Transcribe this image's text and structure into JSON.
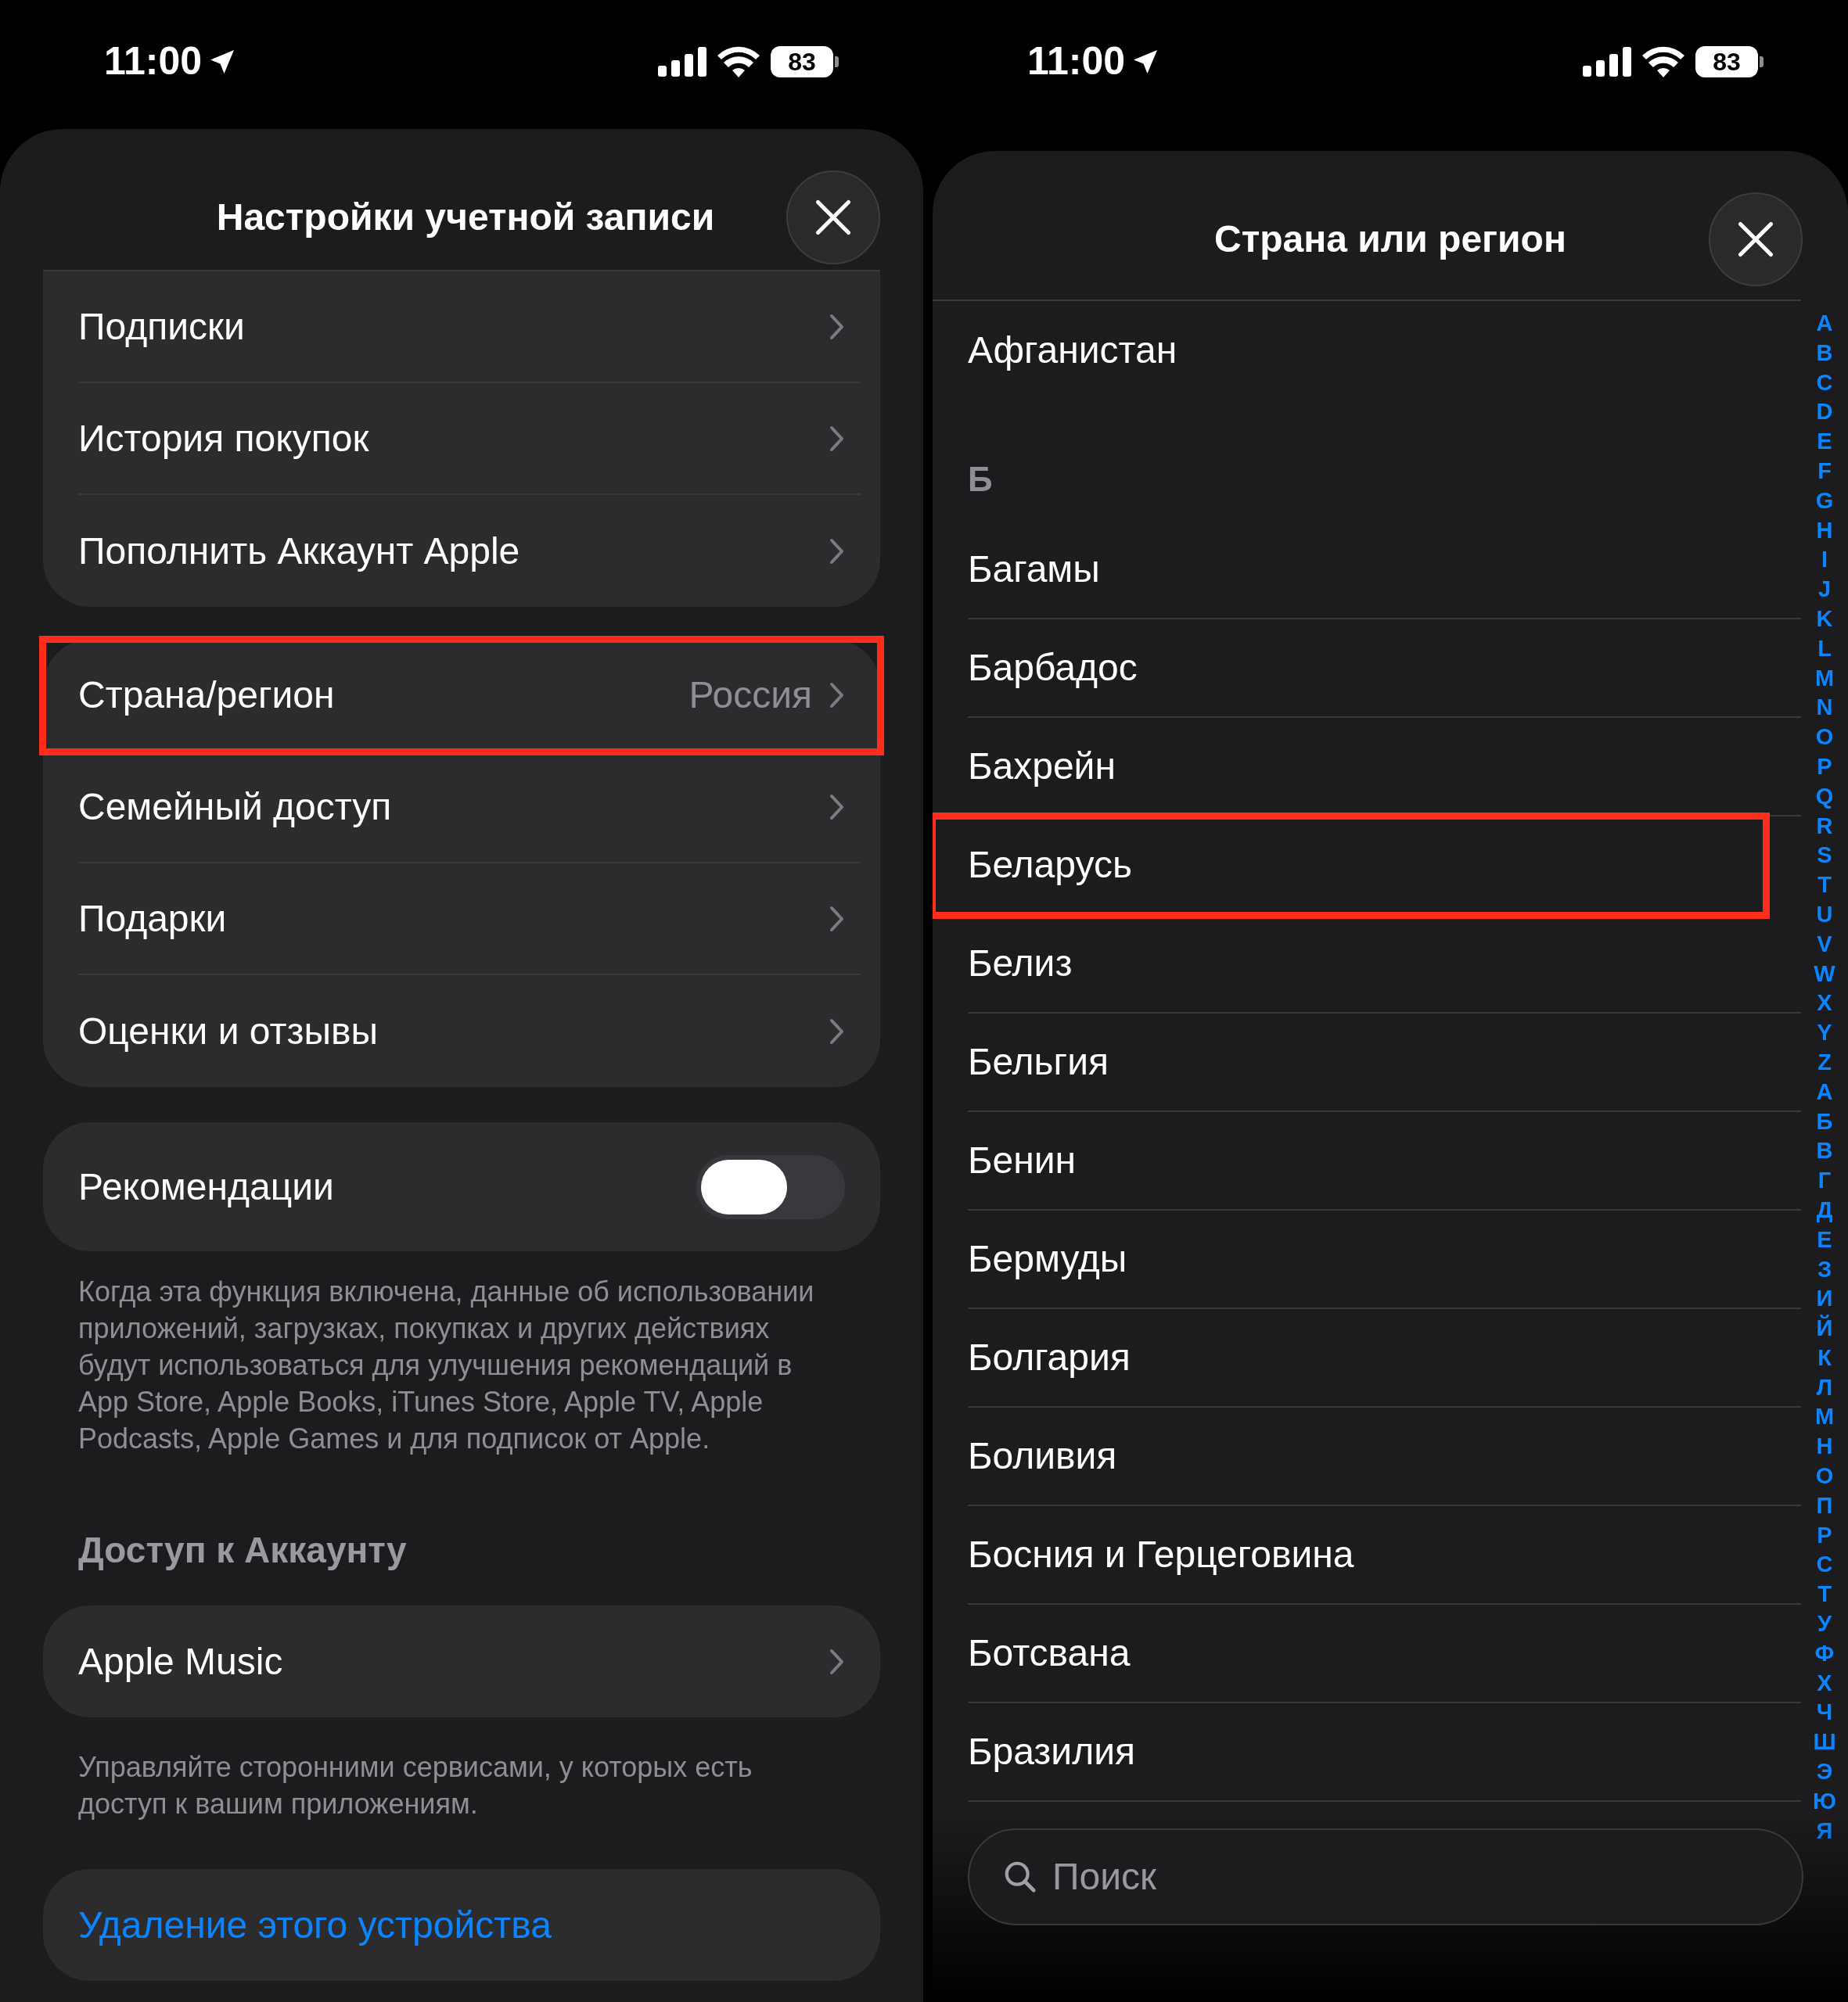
{
  "left_screen": {
    "status_bar": {
      "time": "11:00",
      "battery": "83"
    },
    "title": "Настройки учетной записи",
    "group_1": [
      {
        "label": "Подписки",
        "highlighted": false
      },
      {
        "label": "История покупок",
        "highlighted": false
      },
      {
        "label": "Пополнить Аккаунт Apple",
        "highlighted": false
      }
    ],
    "group_2": [
      {
        "label": "Страна/регион",
        "value": "Россия",
        "highlighted": true
      },
      {
        "label": "Семейный доступ",
        "highlighted": false
      },
      {
        "label": "Подарки",
        "highlighted": false
      },
      {
        "label": "Оценки и отзывы",
        "highlighted": false
      }
    ],
    "toggle": {
      "label": "Рекомендации",
      "on": false
    },
    "toggle_note": "Когда эта функция включена, данные об использовании приложений, загрузках, покупках и других действиях будут использоваться для улучшения рекомендаций в App Store, Apple Books, iTunes Store, Apple TV, Apple Podcasts, Apple Games и для подписок от Apple.",
    "section_header": "Доступ к Аккаунту",
    "access_rows": [
      {
        "label": "Apple Music"
      }
    ],
    "access_note": "Управляйте сторонними сервисами, у которых есть доступ к вашим приложениям.",
    "delete_link": "Удаление этого устройства"
  },
  "right_screen": {
    "status_bar": {
      "time": "11:00",
      "battery": "83"
    },
    "title": "Страна или регион",
    "rows": [
      {
        "kind": "country",
        "label": "Афганистан",
        "highlighted": false
      },
      {
        "kind": "section",
        "label": "Б"
      },
      {
        "kind": "country",
        "label": "Багамы",
        "highlighted": false
      },
      {
        "kind": "country",
        "label": "Барбадос",
        "highlighted": false
      },
      {
        "kind": "country",
        "label": "Бахрейн",
        "highlighted": false
      },
      {
        "kind": "country",
        "label": "Беларусь",
        "highlighted": true
      },
      {
        "kind": "country",
        "label": "Белиз",
        "highlighted": false
      },
      {
        "kind": "country",
        "label": "Бельгия",
        "highlighted": false
      },
      {
        "kind": "country",
        "label": "Бенин",
        "highlighted": false
      },
      {
        "kind": "country",
        "label": "Бермуды",
        "highlighted": false
      },
      {
        "kind": "country",
        "label": "Болгария",
        "highlighted": false
      },
      {
        "kind": "country",
        "label": "Боливия",
        "highlighted": false
      },
      {
        "kind": "country",
        "label": "Босния и Герцеговина",
        "highlighted": false
      },
      {
        "kind": "country",
        "label": "Ботсвана",
        "highlighted": false
      },
      {
        "kind": "country",
        "label": "Бразилия",
        "highlighted": false
      }
    ],
    "index": [
      "A",
      "B",
      "C",
      "D",
      "E",
      "F",
      "G",
      "H",
      "I",
      "J",
      "K",
      "L",
      "M",
      "N",
      "O",
      "P",
      "Q",
      "R",
      "S",
      "T",
      "U",
      "V",
      "W",
      "X",
      "Y",
      "Z",
      "А",
      "Б",
      "В",
      "Г",
      "Д",
      "Е",
      "З",
      "И",
      "Й",
      "К",
      "Л",
      "М",
      "Н",
      "О",
      "П",
      "Р",
      "С",
      "Т",
      "У",
      "Ф",
      "Х",
      "Ч",
      "Ш",
      "Э",
      "Ю",
      "Я"
    ],
    "search": {
      "placeholder": "Поиск"
    }
  }
}
